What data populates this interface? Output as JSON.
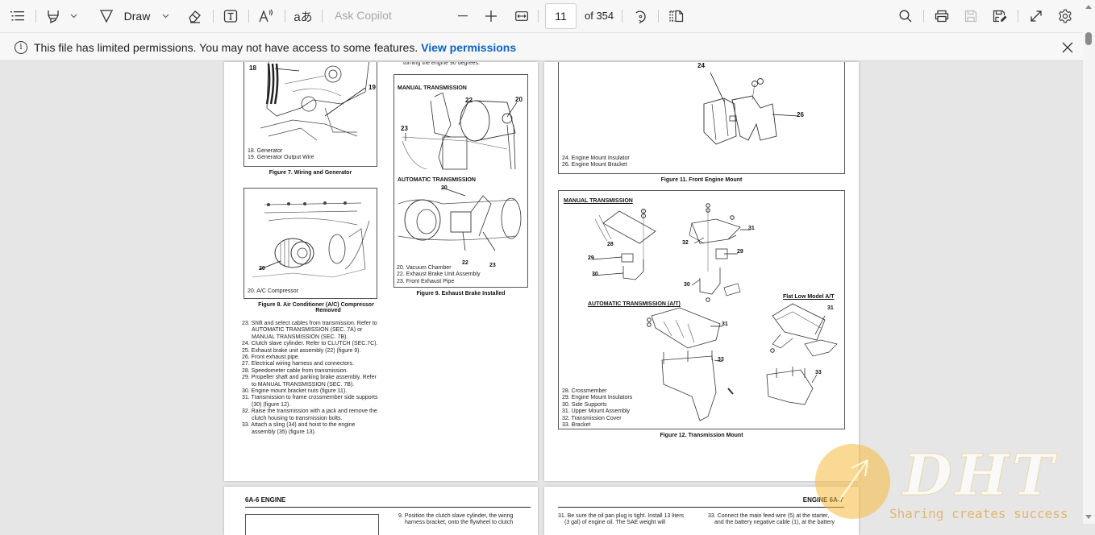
{
  "toolbar": {
    "contents_icon": "table-of-contents-icon",
    "highlight_icon": "highlighter-icon",
    "draw_label": "Draw",
    "erase_icon": "eraser-icon",
    "text_icon": "add-text-icon",
    "read_aloud_icon": "read-aloud-icon",
    "translate_icon": "translate-icon",
    "copilot_placeholder": "Ask Copilot",
    "zoom_out_icon": "minus-icon",
    "zoom_in_icon": "plus-icon",
    "fit_icon": "fit-to-width-icon",
    "current_page": "11",
    "page_total": "of 354",
    "rotate_icon": "rotate-icon",
    "page_view_icon": "page-view-icon",
    "search_icon": "search-icon",
    "print_icon": "print-icon",
    "save_icon": "save-icon",
    "save_as_icon": "save-as-icon",
    "fullscreen_icon": "fullscreen-icon",
    "settings_icon": "settings-icon"
  },
  "infobar": {
    "message": "This file has limited permissions. You may not have access to some features.",
    "link": "View permissions"
  },
  "document": {
    "page_left": {
      "top_text": "turning the engine 90 degrees.",
      "fig7": {
        "callouts": [
          "18",
          "19"
        ],
        "legend": [
          "18. Generator",
          "19. Generator Output Wire"
        ],
        "caption": "Figure 7.  Wiring and Generator"
      },
      "fig8": {
        "callouts": [
          "20"
        ],
        "legend": [
          "20. A/C Compressor"
        ],
        "caption_line1": "Figure 8.   Air Conditioner (A/C) Compressor",
        "caption_line2": "Removed"
      },
      "fig9": {
        "subhead_manual": "MANUAL TRANSMISSION",
        "subhead_auto": "AUTOMATIC TRANSMISSION",
        "callouts": [
          "22",
          "20",
          "23",
          "20",
          "22",
          "23"
        ],
        "legend": [
          "20. Vacuum Chamber",
          "22. Exhaust Brake Unit Assembly",
          "23. Front Exhaust Pipe"
        ],
        "caption": "Figure 9.  Exhaust Brake Installed"
      },
      "steps": [
        "23. Shift and select cables from transmission. Refer to AUTOMATIC TRANSMISSION (SEC. 7A) or MANUAL TRANSMISSION (SEC. 7B).",
        "24. Clutch slave cylinder. Refer to CLUTCH (SEC.7C).",
        "25. Exhaust brake unit assembly (22) (figure 9).",
        "26. Front exhaust pipe.",
        "27. Electrical wiring harness and connectors.",
        "28. Speedometer cable from transmission.",
        "29. Propeller shaft and parking brake assembly. Refer to MANUAL TRANSMISSION (SEC. 7B).",
        "30. Engine mount bracket nuts (figure 11).",
        "31. Transmission to frame crossmember side supports (30) (figure 12).",
        "32. Raise the transmission with a jack and remove the clutch housing to transmission bolts.",
        "33. Attach a sling (34) and hoist to the engine assembly (35) (figure 13)."
      ]
    },
    "page_right": {
      "fig11": {
        "callouts": [
          "24",
          "26"
        ],
        "legend": [
          "24. Engine Mount Insulator",
          "26. Engine Mount Bracket"
        ],
        "caption": "Figure 11.  Front Engine Mount"
      },
      "fig12": {
        "subhead_manual": "MANUAL TRANSMISSION",
        "subhead_auto": "AUTOMATIC TRANSMISSION (A/T)",
        "subhead_flat": "Flat Low Model A/T",
        "callouts": [
          "28",
          "29",
          "30",
          "31",
          "32",
          "29",
          "30",
          "31",
          "33",
          "31",
          "33"
        ],
        "legend": [
          "28. Crossmember",
          "29. Engine Mount Insulators",
          "30. Side Supports",
          "31. Upper Mount Assembly",
          "32. Transmission Cover",
          "33. Bracket"
        ],
        "caption": "Figure 12.  Transmission Mount"
      }
    },
    "page_next_left": {
      "header": "6A-6 ENGINE",
      "text": "9. Position the clutch slave cylinder, the wiring",
      "text2": "harness bracket, onto the flywheel to clutch"
    },
    "page_next_right": {
      "header": "ENGINE 6A-7",
      "text_col1": "31. Be sure the oil pan plug is tight. Install 13 liters",
      "text_col1b": "(3 gal) of engine oil. The SAE weight will",
      "text_col2": "33. Connect the main feed wire (5) at the starter,",
      "text_col2b": "and the battery negative cable (1), at the battery"
    }
  },
  "watermark": {
    "logo": "DHT",
    "tagline": "Sharing creates success"
  }
}
